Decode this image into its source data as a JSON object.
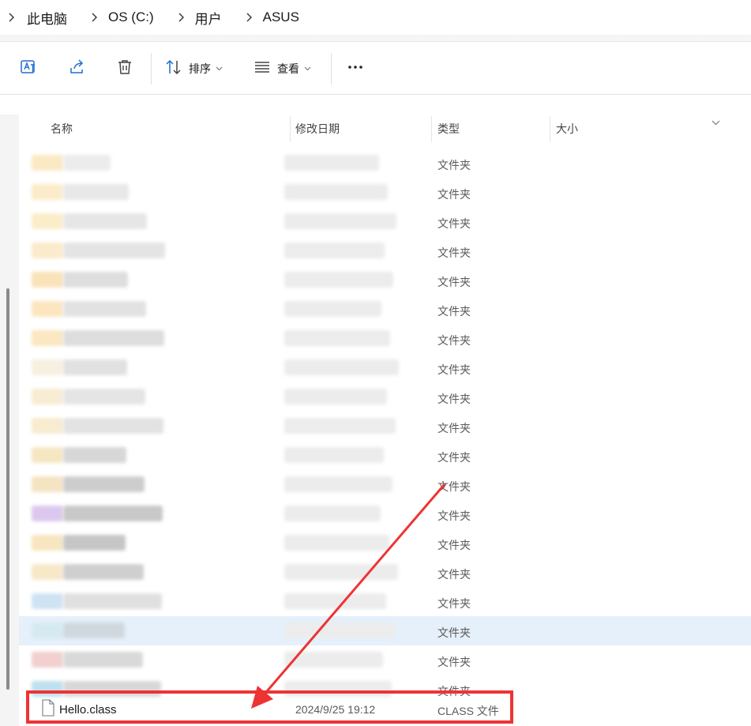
{
  "breadcrumb": {
    "items": [
      "此电脑",
      "OS (C:)",
      "用户",
      "ASUS"
    ]
  },
  "toolbar": {
    "translate_icon": "translate-icon",
    "share_icon": "share-icon",
    "delete_icon": "trash-icon",
    "sort_label": "排序",
    "view_label": "查看",
    "more_label": "•••"
  },
  "columns": {
    "name": "名称",
    "modified": "修改日期",
    "type": "类型",
    "size": "大小"
  },
  "rows": [
    {
      "type": "文件夹",
      "icon": "folder-icon"
    },
    {
      "type": "文件夹",
      "icon": "folder-icon"
    },
    {
      "type": "文件夹",
      "icon": "folder-icon"
    },
    {
      "type": "文件夹",
      "icon": "folder-icon"
    },
    {
      "type": "文件夹",
      "icon": "folder-icon"
    },
    {
      "type": "文件夹",
      "icon": "folder-icon"
    },
    {
      "type": "文件夹",
      "icon": "folder-icon"
    },
    {
      "type": "文件夹",
      "icon": "folder-icon"
    },
    {
      "type": "文件夹",
      "icon": "folder-icon"
    },
    {
      "type": "文件夹",
      "icon": "folder-icon"
    },
    {
      "type": "文件夹",
      "icon": "folder-icon"
    },
    {
      "type": "文件夹",
      "icon": "folder-icon"
    },
    {
      "type": "文件夹",
      "icon": "folder-icon"
    },
    {
      "type": "文件夹",
      "icon": "folder-icon"
    },
    {
      "type": "文件夹",
      "icon": "folder-icon"
    },
    {
      "type": "文件夹",
      "icon": "folder-icon"
    },
    {
      "type": "文件夹",
      "icon": "folder-icon",
      "selected": true
    },
    {
      "type": "文件夹",
      "icon": "folder-icon"
    },
    {
      "type": "文件夹",
      "icon": "folder-icon"
    }
  ],
  "highlighted_file": {
    "name": "Hello.class",
    "modified": "2024/9/25 19:12",
    "type": "CLASS 文件",
    "icon": "file-icon"
  },
  "colors": {
    "selection": "#e5f0fb",
    "annotation_red": "#ee3333",
    "accent": "#0067c0"
  }
}
